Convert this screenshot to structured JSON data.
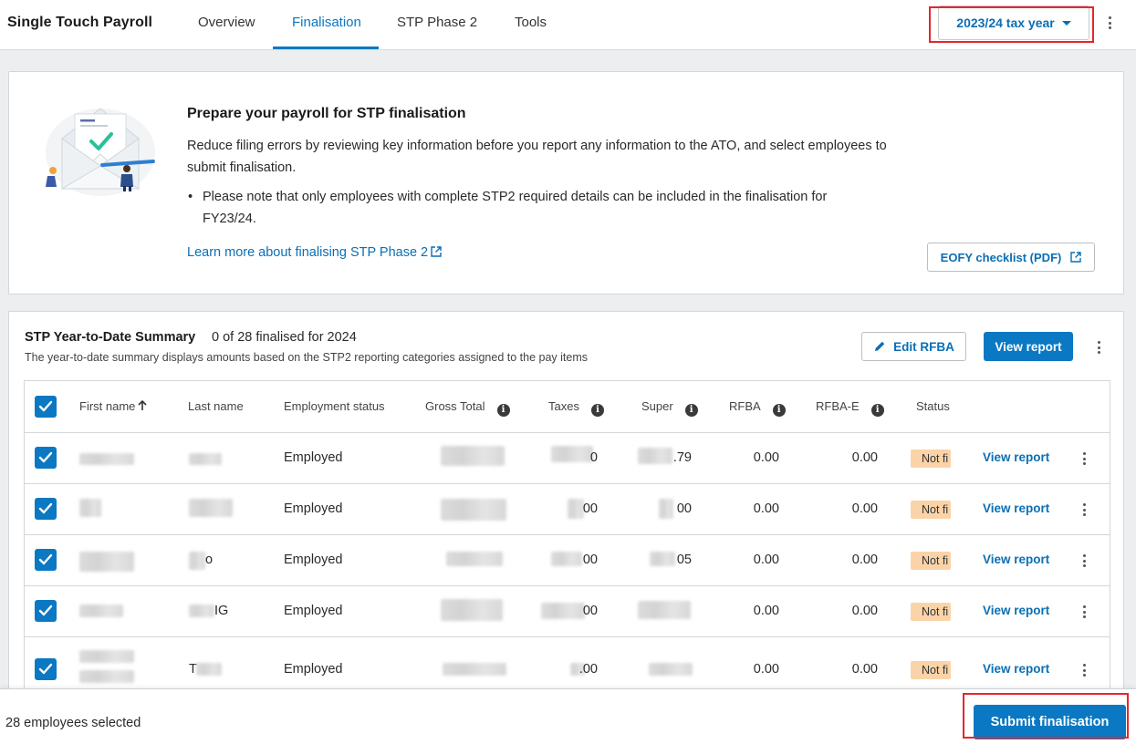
{
  "header": {
    "app_title": "Single Touch Payroll",
    "tabs": [
      {
        "label": "Overview"
      },
      {
        "label": "Finalisation"
      },
      {
        "label": "STP Phase 2"
      },
      {
        "label": "Tools"
      }
    ],
    "active_tab": "Finalisation",
    "tax_year_label": "2023/24 tax year"
  },
  "info_card": {
    "title": "Prepare your payroll for STP finalisation",
    "description": "Reduce filing errors by reviewing key information before you report any information to the ATO, and select employees to submit finalisation.",
    "bullet": "Please note that only employees with complete STP2 required details can be included in the finalisation for FY23/24.",
    "learn_more_link": "Learn more about finalising STP Phase 2",
    "eofy_button": "EOFY checklist (PDF)"
  },
  "summary": {
    "title": "STP Year-to-Date Summary",
    "count_text": "0 of 28 finalised for 2024",
    "subtitle": "The year-to-date summary displays amounts based on the STP2 reporting categories assigned to the pay items",
    "edit_button": "Edit RFBA",
    "view_report_button": "View report",
    "columns": {
      "first_name": "First name",
      "last_name": "Last name",
      "employment_status": "Employment status",
      "gross_total": "Gross Total",
      "taxes": "Taxes",
      "super": "Super",
      "rfba": "RFBA",
      "rfba_e": "RFBA-E",
      "status": "Status"
    },
    "rows": [
      {
        "last_name": "",
        "employment_status": "Employed",
        "taxes": "0",
        "super": ".79",
        "rfba": "0.00",
        "rfba_e": "0.00",
        "status": "Not fi",
        "link": "View report"
      },
      {
        "last_name": "",
        "employment_status": "Employed",
        "taxes": "00",
        "super": "00",
        "rfba": "0.00",
        "rfba_e": "0.00",
        "status": "Not fi",
        "link": "View report"
      },
      {
        "last_name": "o",
        "employment_status": "Employed",
        "taxes": "00",
        "super": "05",
        "rfba": "0.00",
        "rfba_e": "0.00",
        "status": "Not fi",
        "link": "View report"
      },
      {
        "last_name": "IG",
        "employment_status": "Employed",
        "taxes": "00",
        "super": "",
        "rfba": "0.00",
        "rfba_e": "0.00",
        "status": "Not fi",
        "link": "View report"
      },
      {
        "last_name": "T",
        "employment_status": "Employed",
        "taxes": ".00",
        "super": "",
        "rfba": "0.00",
        "rfba_e": "0.00",
        "status": "Not fi",
        "link": "View report"
      }
    ]
  },
  "footer": {
    "selected_text": "28 employees selected",
    "submit_button": "Submit finalisation"
  },
  "colors": {
    "accent": "#0a78c2",
    "highlight": "#e5262c",
    "status_badge": "#fbd3a8"
  }
}
